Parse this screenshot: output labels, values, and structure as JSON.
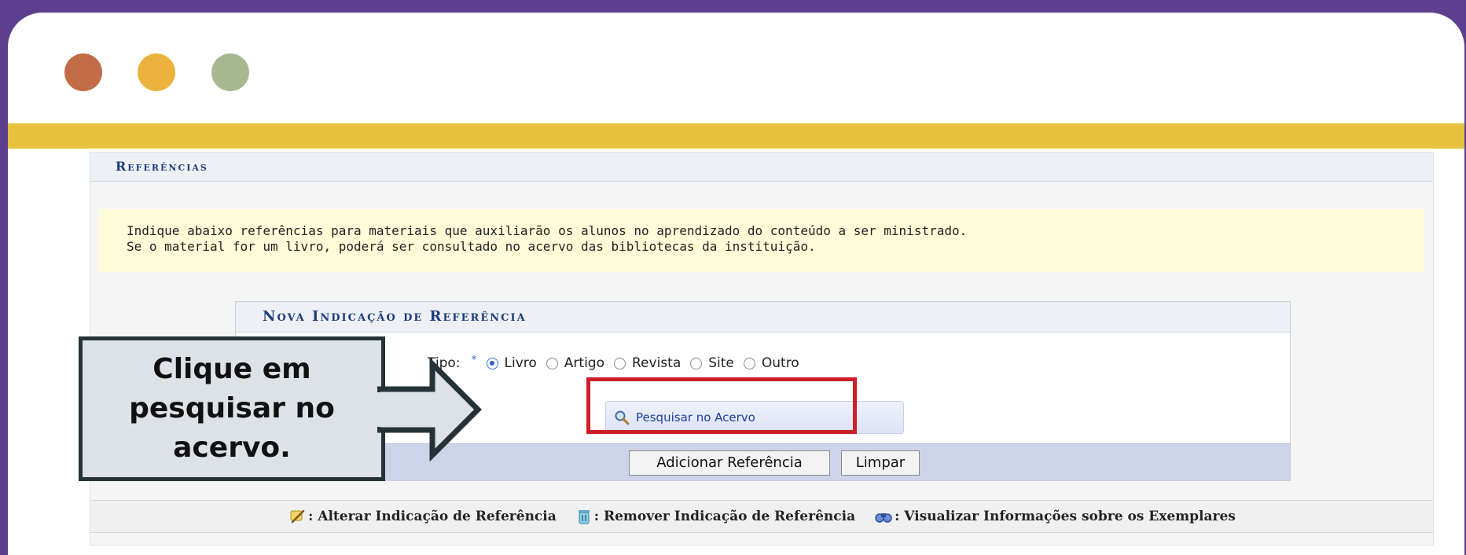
{
  "window": {
    "dots": [
      "#c26b47",
      "#ebb33d",
      "#a7b890"
    ],
    "stripe_color": "#e8c23d"
  },
  "references": {
    "title": "Referências",
    "notice_line1": "Indique abaixo referências para materiais que auxiliarão os alunos no aprendizado do conteúdo a ser ministrado.",
    "notice_line2": "Se o material for um livro, poderá ser consultado no acervo das bibliotecas da instituição.",
    "form": {
      "title": "Nova Indicação de Referência",
      "tipo_label": "Tipo:",
      "required_mark": "*",
      "options": [
        {
          "label": "Livro",
          "checked": true
        },
        {
          "label": "Artigo",
          "checked": false
        },
        {
          "label": "Revista",
          "checked": false
        },
        {
          "label": "Site",
          "checked": false
        },
        {
          "label": "Outro",
          "checked": false
        }
      ],
      "search_button": "Pesquisar no Acervo",
      "add_button": "Adicionar Referência",
      "clear_button": "Limpar"
    },
    "legend": [
      {
        "icon": "pencil-icon",
        "text": ": Alterar Indicação de Referência"
      },
      {
        "icon": "trash-icon",
        "text": ": Remover Indicação de Referência"
      },
      {
        "icon": "binoculars-icon",
        "text": ": Visualizar Informações sobre os Exemplares"
      }
    ]
  },
  "callout": {
    "line1": "Clique em",
    "line2": "pesquisar no",
    "line3": "acervo."
  },
  "colors": {
    "background": "#5e3f8f",
    "highlight": "#cc1f28",
    "link": "#1c3ea0"
  }
}
